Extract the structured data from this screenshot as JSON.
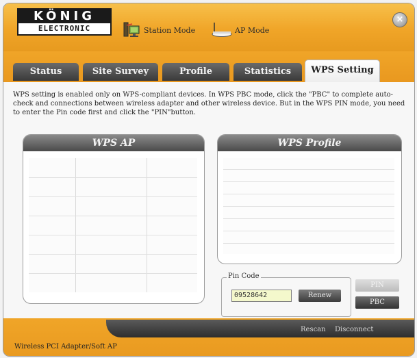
{
  "header": {
    "logo_top": "KÖNIG",
    "logo_bottom": "ELECTRONIC",
    "station_mode_label": "Station Mode",
    "ap_mode_label": "AP Mode",
    "close_symbol": "×"
  },
  "tabs": [
    {
      "label": "Status"
    },
    {
      "label": "Site Survey"
    },
    {
      "label": "Profile"
    },
    {
      "label": "Statistics"
    },
    {
      "label": "WPS Setting"
    }
  ],
  "active_tab": "WPS Setting",
  "description": "WPS setting is enabled only on WPS-compliant devices. In WPS PBC mode, click the \"PBC\" to complete auto-check and connections between wireless adapter and other wireless device. But in the WPS PIN mode, you need to enter the Pin code first and click the \"PIN\"button.",
  "wps_ap": {
    "title": "WPS AP"
  },
  "wps_profile": {
    "title": "WPS Profile"
  },
  "pin": {
    "legend": "Pin Code",
    "value": "09528642",
    "renew_label": "Renew"
  },
  "buttons": {
    "pin_label": "PIN",
    "pbc_label": "PBC"
  },
  "footer": {
    "rescan_label": "Rescan",
    "disconnect_label": "Disconnect",
    "status_text": "Wireless PCI Adapter/Soft AP"
  },
  "colors": {
    "accent_orange": "#f0a528",
    "tab_dark": "#4a4a4a",
    "pin_field_bg": "#f4f8cc"
  }
}
